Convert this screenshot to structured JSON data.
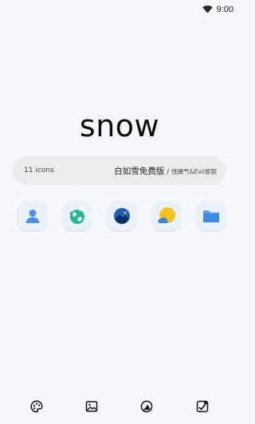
{
  "status_bar": {
    "time": "9:00",
    "wifi_icon": "wifi-icon"
  },
  "header": {
    "title": "snow"
  },
  "info": {
    "icon_count": "11 icons",
    "author_main": "白如雪免费版",
    "separator": "/",
    "author_secondary": "怪脾气&Evil邪契"
  },
  "preview_icons": [
    {
      "name": "contacts-icon",
      "color": "#4a90e2"
    },
    {
      "name": "globe-icon",
      "color": "#1fb89a"
    },
    {
      "name": "wallpaper-icon",
      "color": "#1e5fb8"
    },
    {
      "name": "weather-icon",
      "color": "#f5c518"
    },
    {
      "name": "folder-icon",
      "color": "#3d8ae6"
    }
  ],
  "bottom_nav": [
    {
      "name": "theme-palette-icon"
    },
    {
      "name": "wallpaper-gallery-icon"
    },
    {
      "name": "icon-pack-icon"
    },
    {
      "name": "apply-icon"
    }
  ],
  "colors": {
    "background": "#f6f7fa",
    "pill": "#ececef",
    "icon_tile": "#e9f1fb"
  }
}
